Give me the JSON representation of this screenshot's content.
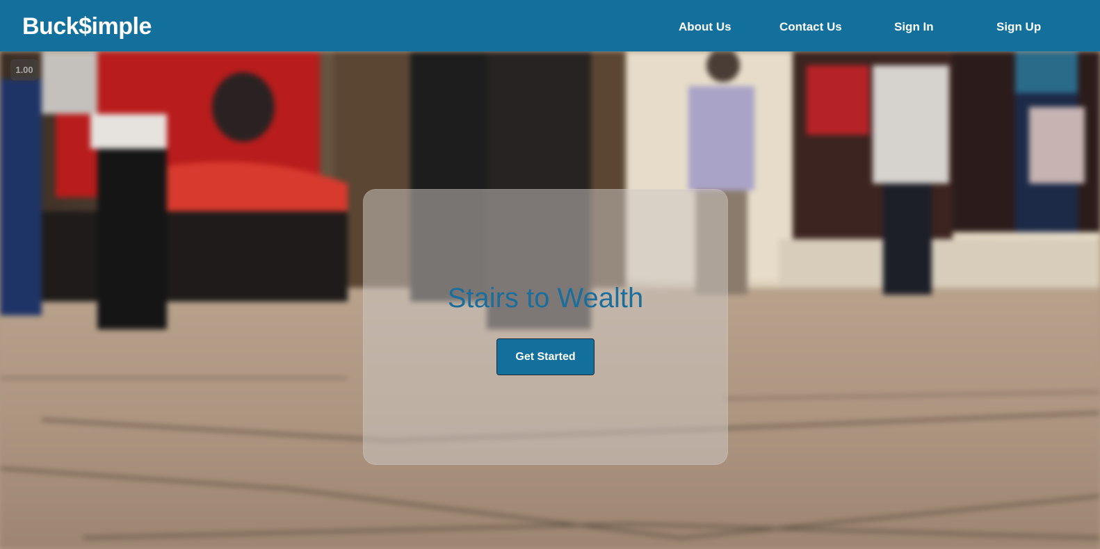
{
  "navbar": {
    "brand": "Buck$imple",
    "links": [
      "About Us",
      "Contact Us",
      "Sign In",
      "Sign Up"
    ]
  },
  "video": {
    "playback_speed": "1.00"
  },
  "hero": {
    "title": "Stairs to Wealth",
    "cta_label": "Get Started"
  },
  "colors": {
    "brand_blue": "#13709c",
    "title_blue": "#1b6e9b",
    "nav_text": "#ffffff"
  }
}
